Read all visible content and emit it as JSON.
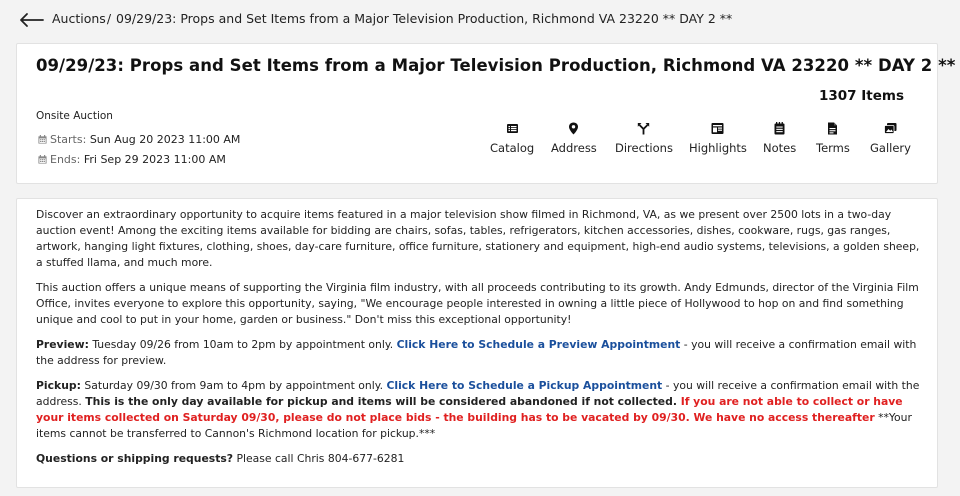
{
  "breadcrumb": {
    "root": "Auctions",
    "separator": "/",
    "current": "09/29/23: Props and Set Items from a Major Television Production, Richmond VA 23220 ** DAY 2 **"
  },
  "auction": {
    "title": "09/29/23: Props and Set Items from a Major Television Production, Richmond VA 23220 ** DAY 2 **",
    "item_count": "1307 Items",
    "type": "Onsite Auction",
    "starts_label": "Starts:",
    "starts_value": "Sun Aug 20 2023 11:00 AM",
    "ends_label": "Ends:",
    "ends_value": "Fri Sep 29 2023 11:00 AM"
  },
  "nav": [
    {
      "label": "Catalog",
      "icon": "catalog-icon"
    },
    {
      "label": "Address",
      "icon": "location-pin-icon"
    },
    {
      "label": "Directions",
      "icon": "directions-icon"
    },
    {
      "label": "Highlights",
      "icon": "highlights-icon"
    },
    {
      "label": "Notes",
      "icon": "notes-icon"
    },
    {
      "label": "Terms",
      "icon": "terms-icon"
    },
    {
      "label": "Gallery",
      "icon": "gallery-icon"
    }
  ],
  "description": {
    "p1": "Discover an extraordinary opportunity to acquire items featured in a major television show filmed in Richmond, VA, as we present over 2500 lots in a two-day auction event! Among the exciting items available for bidding are chairs, sofas, tables, refrigerators, kitchen accessories, dishes, cookware, rugs, gas ranges, artwork, hanging light fixtures, clothing, shoes, day-care furniture, office furniture, stationery and equipment, high-end audio systems, televisions, a golden sheep, a stuffed llama, and much more.",
    "p2": "This auction offers a unique means of supporting the Virginia film industry, with all proceeds contributing to its growth. Andy Edmunds, director of the Virginia Film Office, invites everyone to explore this opportunity, saying, \"We encourage people interested in owning a little piece of Hollywood to hop on and find something unique and cool to put in your home, garden or business.\" Don't miss this exceptional opportunity!",
    "preview_label": "Preview:",
    "preview_text": " Tuesday 09/26 from 10am to 2pm by appointment only. ",
    "preview_link": "Click Here to Schedule a Preview Appointment",
    "preview_after": " - you will receive a confirmation email with the address for preview.",
    "pickup_label": "Pickup:",
    "pickup_text": " Saturday 09/30 from 9am to 4pm by appointment only. ",
    "pickup_link": "Click Here to Schedule a Pickup Appointment",
    "pickup_after": " - you will receive a confirmation email with the address. ",
    "pickup_bold": "This is the only day available for pickup and items will be considered abandoned if not collected.",
    "pickup_red": " If you are not able to collect or have your items collected on Saturday 09/30, please do not place bids - the building has to be vacated by 09/30. We have no access thereafter",
    "pickup_tail": " **Your items cannot be transferred to Cannon's Richmond location for pickup.***",
    "questions_label": "Questions or shipping requests?",
    "questions_text": " Please call Chris 804-677-6281"
  },
  "colors": {
    "link": "#1a4f9c",
    "warning": "#e02020",
    "background": "#f3f3f3"
  }
}
